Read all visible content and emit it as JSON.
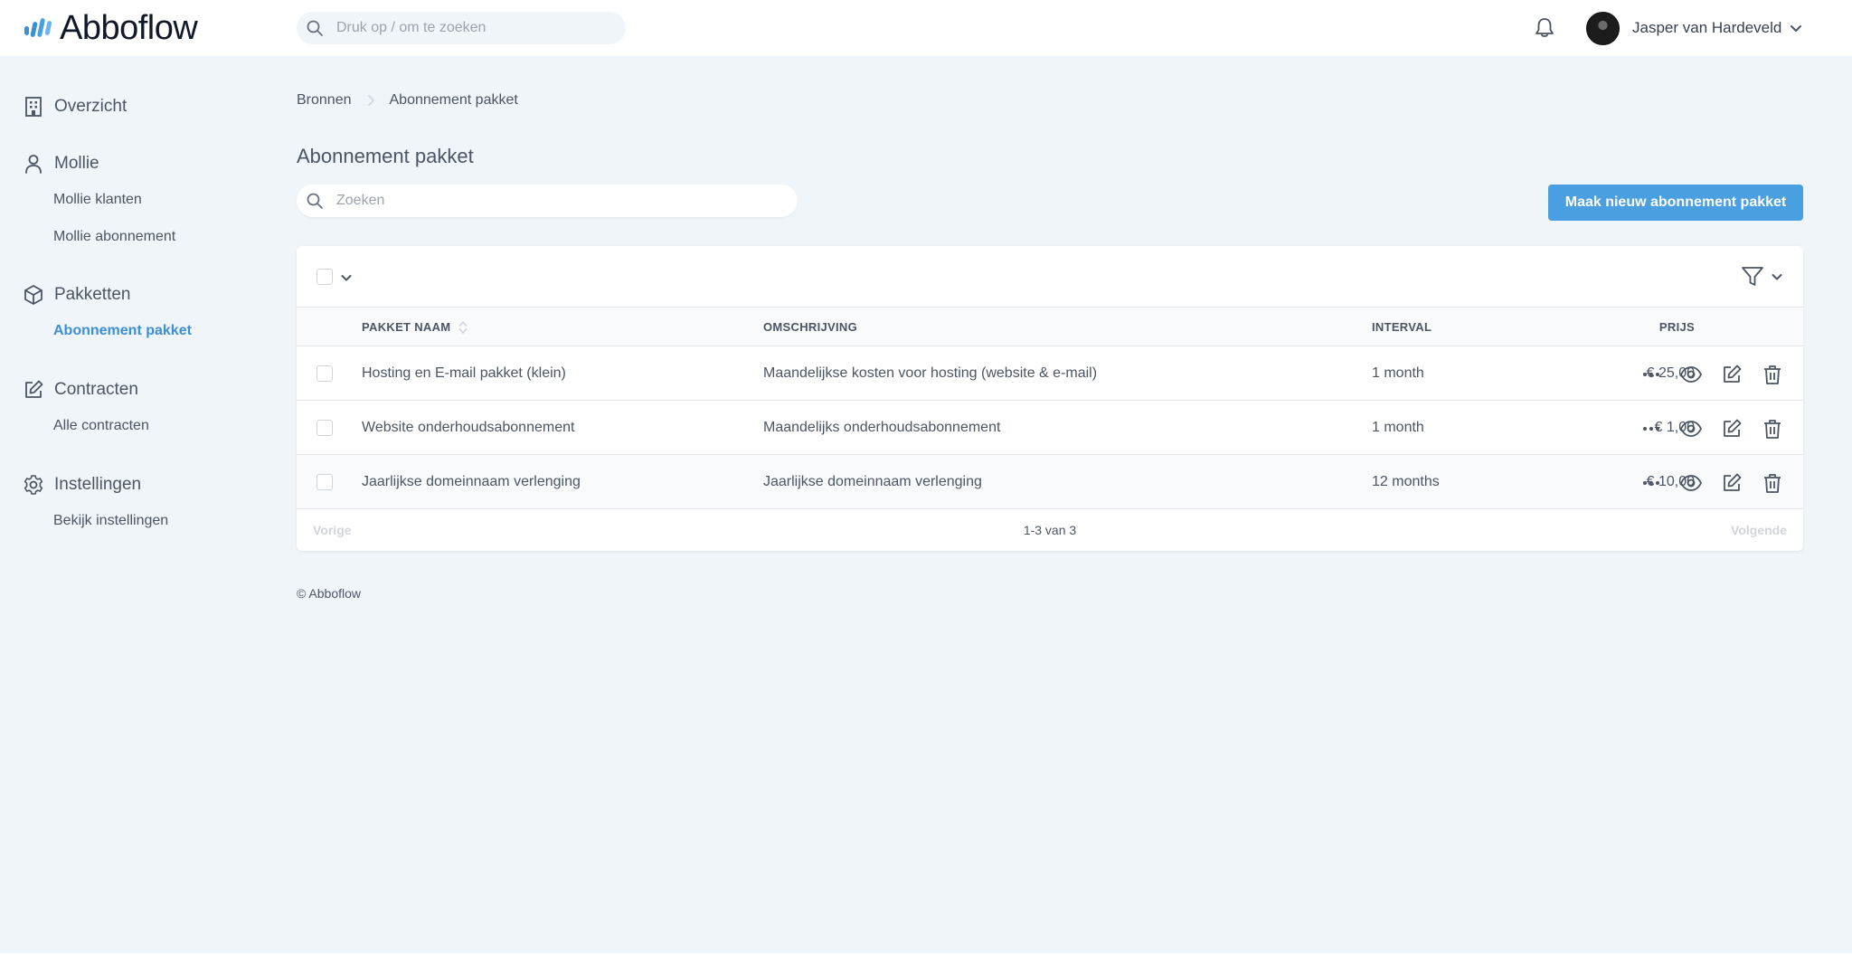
{
  "app": {
    "name": "Abboflow"
  },
  "colors": {
    "accent": "#4a9fe0",
    "active_link": "#3b8fd8",
    "background": "#f0f5f9"
  },
  "header": {
    "search_placeholder": "Druk op / om te zoeken",
    "user_name": "Jasper van Hardeveld",
    "icons": {
      "search": "search-icon",
      "notifications": "bell-icon",
      "user_menu": "chevron-down-icon"
    }
  },
  "sidebar": {
    "groups": [
      {
        "label": "Overzicht",
        "icon": "building-icon",
        "items": []
      },
      {
        "label": "Mollie",
        "icon": "user-icon",
        "items": [
          {
            "label": "Mollie klanten"
          },
          {
            "label": "Mollie abonnement"
          }
        ]
      },
      {
        "label": "Pakketten",
        "icon": "cube-icon",
        "items": [
          {
            "label": "Abonnement pakket",
            "active": true
          }
        ]
      },
      {
        "label": "Contracten",
        "icon": "edit-icon",
        "items": [
          {
            "label": "Alle contracten"
          }
        ]
      },
      {
        "label": "Instellingen",
        "icon": "gear-icon",
        "items": [
          {
            "label": "Bekijk instellingen"
          }
        ]
      }
    ]
  },
  "breadcrumb": [
    "Bronnen",
    "Abonnement pakket"
  ],
  "page": {
    "title": "Abonnement pakket",
    "search_placeholder": "Zoeken",
    "create_button": "Maak nieuw abonnement pakket"
  },
  "table": {
    "columns": {
      "name": "PAKKET NAAM",
      "description": "OMSCHRIJVING",
      "interval": "INTERVAL",
      "price": "PRIJS"
    },
    "rows": [
      {
        "name": "Hosting en E-mail pakket (klein)",
        "description": "Maandelijkse kosten voor hosting (website & e-mail)",
        "interval": "1 month",
        "price": "€ 25,00"
      },
      {
        "name": "Website onderhoudsabonnement",
        "description": "Maandelijks onderhoudsabonnement",
        "interval": "1 month",
        "price": "€ 1,00"
      },
      {
        "name": "Jaarlijkse domeinnaam verlenging",
        "description": "Jaarlijkse domeinnaam verlenging",
        "interval": "12 months",
        "price": "€ 10,00"
      }
    ],
    "row_actions": [
      "more-icon",
      "eye-icon",
      "edit-icon",
      "trash-icon"
    ]
  },
  "pagination": {
    "prev": "Vorige",
    "info": "1-3 van 3",
    "next": "Volgende"
  },
  "footer": {
    "text": "© Abboflow"
  }
}
